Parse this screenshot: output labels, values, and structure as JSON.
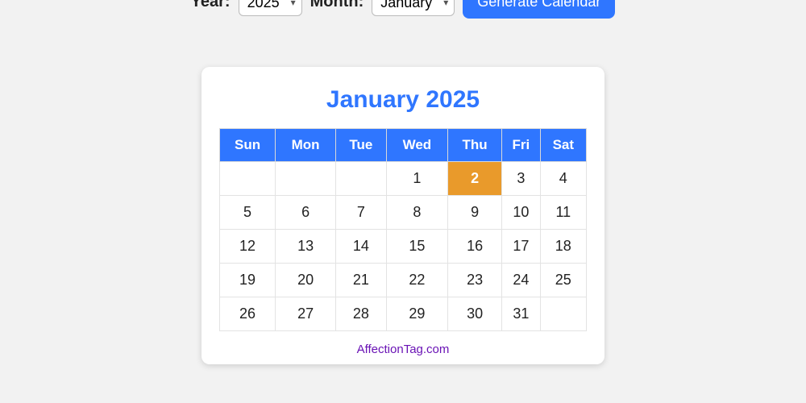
{
  "controls": {
    "year_label": "Year:",
    "year_value": "2025",
    "month_label": "Month:",
    "month_value": "January",
    "generate_label": "Generate Calendar"
  },
  "calendar": {
    "title": "January 2025",
    "day_headers": [
      "Sun",
      "Mon",
      "Tue",
      "Wed",
      "Thu",
      "Fri",
      "Sat"
    ],
    "weeks": [
      [
        "",
        "",
        "",
        "1",
        "2",
        "3",
        "4"
      ],
      [
        "5",
        "6",
        "7",
        "8",
        "9",
        "10",
        "11"
      ],
      [
        "12",
        "13",
        "14",
        "15",
        "16",
        "17",
        "18"
      ],
      [
        "19",
        "20",
        "21",
        "22",
        "23",
        "24",
        "25"
      ],
      [
        "26",
        "27",
        "28",
        "29",
        "30",
        "31",
        ""
      ]
    ],
    "today": "2"
  },
  "footer": {
    "site": "AffectionTag.com"
  },
  "colors": {
    "accent": "#2f76ff",
    "today_bg": "#e99a2b",
    "link": "#6a13b5"
  }
}
